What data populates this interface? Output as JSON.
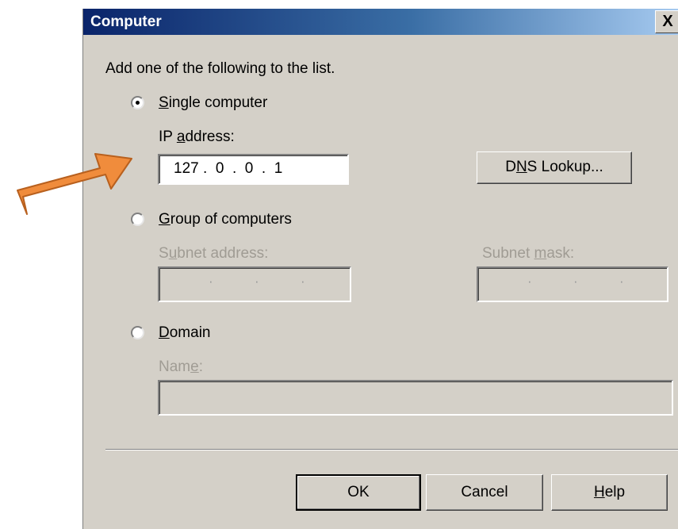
{
  "window": {
    "title": "Computer",
    "close_glyph": "X"
  },
  "instruction": "Add one of the following to the list.",
  "options": {
    "single": {
      "label_accel": "S",
      "label_rest": "ingle computer",
      "selected": true,
      "ip_label_pre": "IP ",
      "ip_label_accel": "a",
      "ip_label_post": "ddress:",
      "ip_value": "127 .  0  .  0  .  1",
      "dns_pre": "D",
      "dns_accel": "N",
      "dns_post": "S Lookup..."
    },
    "group": {
      "label_accel": "G",
      "label_rest": "roup of computers",
      "selected": false,
      "subnet_pre": "S",
      "subnet_accel": "u",
      "subnet_post": "bnet address:",
      "mask_pre": "Subnet ",
      "mask_accel": "m",
      "mask_post": "ask:"
    },
    "domain": {
      "label_accel": "D",
      "label_rest": "omain",
      "selected": false,
      "name_pre": "Nam",
      "name_accel": "e",
      "name_post": ":"
    }
  },
  "buttons": {
    "ok": "OK",
    "cancel": "Cancel",
    "help_accel": "H",
    "help_rest": "elp"
  },
  "annotation": {
    "arrow_color": "#f08c3c"
  }
}
